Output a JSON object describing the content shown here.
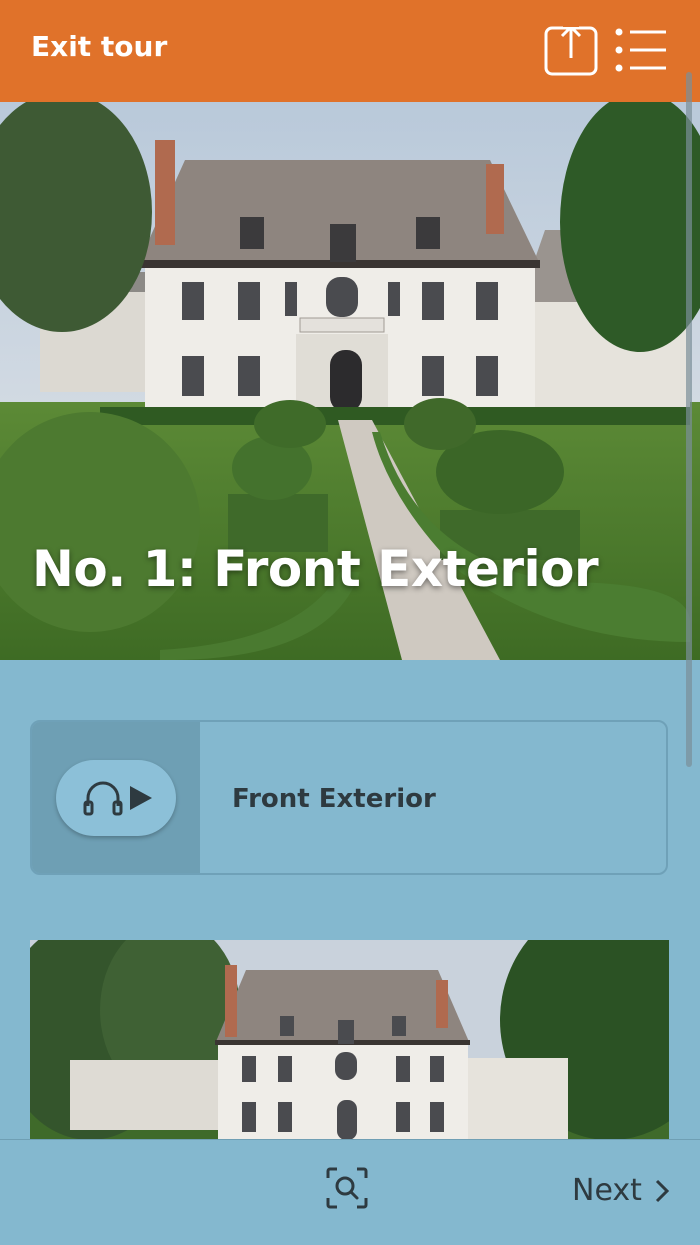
{
  "header": {
    "exit_label": "Exit tour",
    "share_icon": "share-icon",
    "menu_icon": "list-menu-icon",
    "bg_color": "#e0722a"
  },
  "hero": {
    "title": "No. 1: Front Exterior",
    "image": "photo of large white French-style mansion with hedged garden and front walkway"
  },
  "audio": {
    "label": "Front Exterior",
    "icons": [
      "headphones-icon",
      "play-icon"
    ]
  },
  "thumbnail": {
    "image": "photo of white mansion front facade with trees"
  },
  "footer": {
    "zoom_icon": "image-search-icon",
    "next_label": "Next",
    "next_icon": "chevron-right-icon"
  },
  "colors": {
    "accent": "#e0722a",
    "background": "#84b8cf",
    "text_dark": "#2e3a40"
  }
}
